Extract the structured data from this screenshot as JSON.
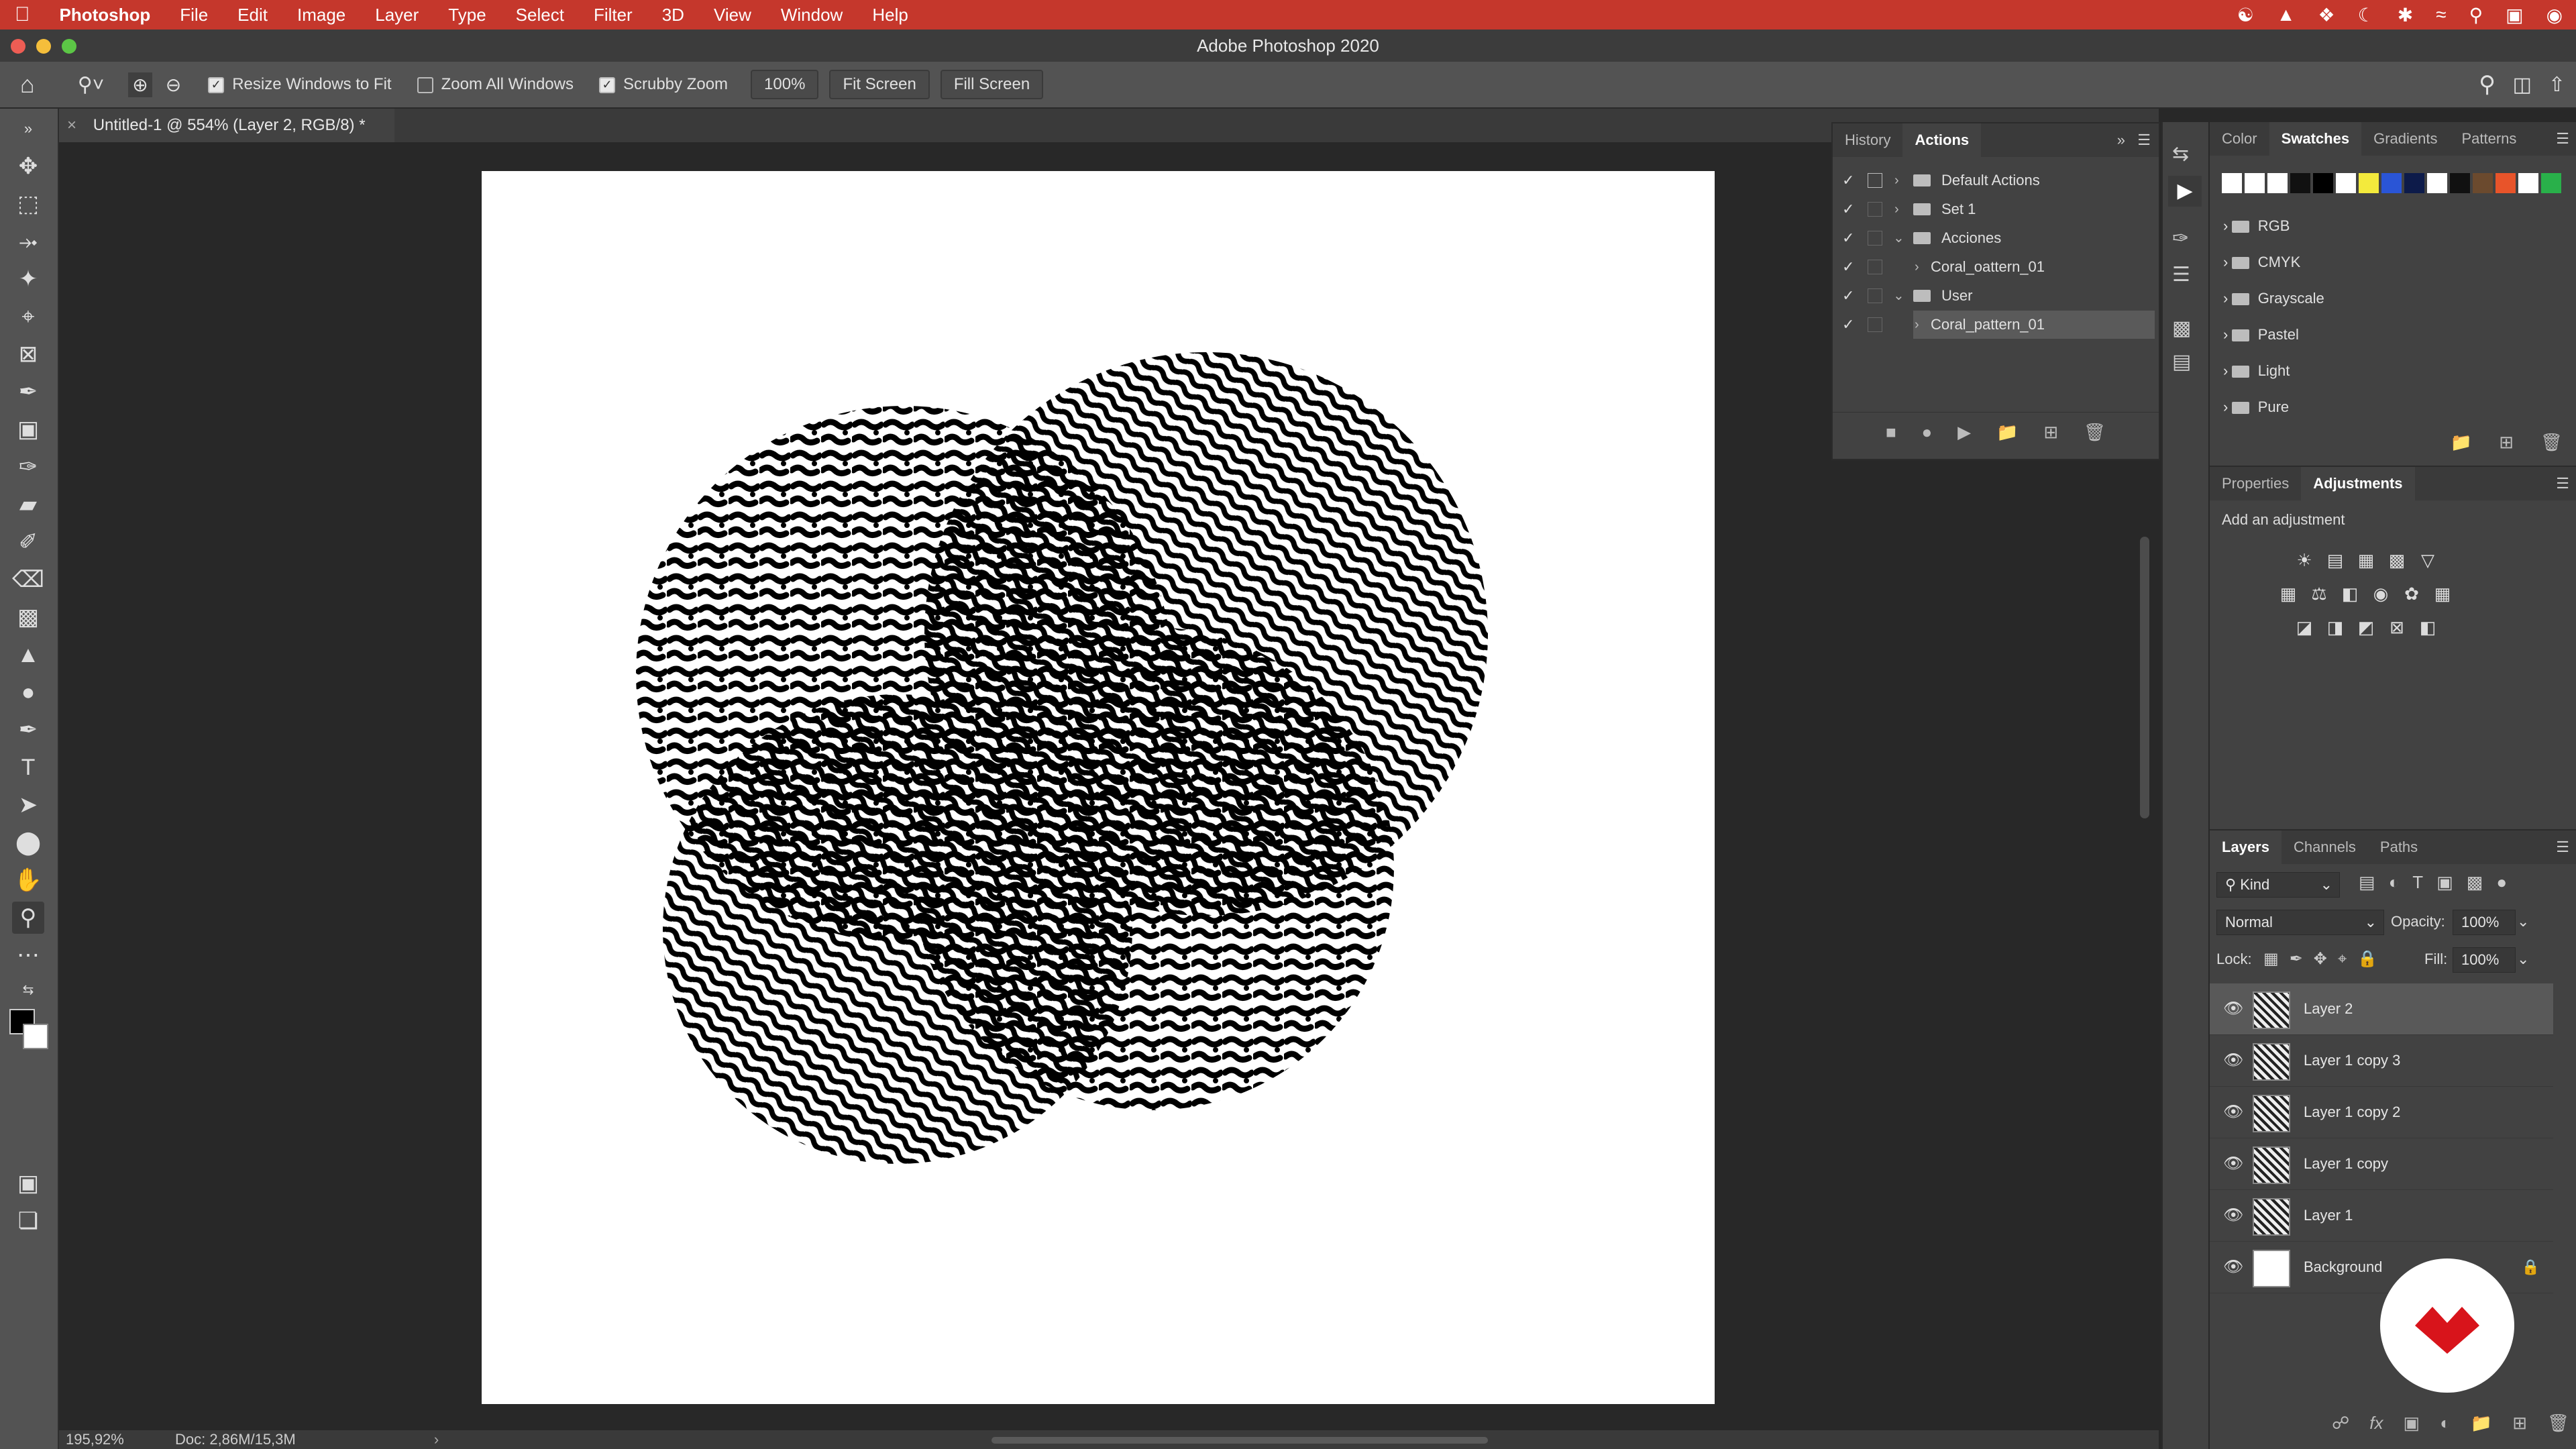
{
  "menubar": {
    "app": "Photoshop",
    "items": [
      "File",
      "Edit",
      "Image",
      "Layer",
      "Type",
      "Select",
      "Filter",
      "3D",
      "View",
      "Window",
      "Help"
    ]
  },
  "window": {
    "title": "Adobe Photoshop 2020"
  },
  "options": {
    "resize_windows": "Resize Windows to Fit",
    "zoom_all": "Zoom All Windows",
    "scrubby": "Scrubby Zoom",
    "zoom_value": "100%",
    "fit_screen": "Fit Screen",
    "fill_screen": "Fill Screen",
    "resize_checked": true,
    "zoom_all_checked": false,
    "scrubby_checked": true
  },
  "document": {
    "tab_title": "Untitled-1 @ 554% (Layer 2, RGB/8) *",
    "zoom": "195,92%",
    "doc_info": "Doc: 2,86M/15,3M"
  },
  "actions_panel": {
    "tabs": [
      "History",
      "Actions"
    ],
    "active_tab": "Actions",
    "rows": [
      "Default Actions",
      "Set 1",
      "Acciones",
      "Coral_oattern_01",
      "User",
      "Coral_pattern_01"
    ]
  },
  "swatches_panel": {
    "tabs": [
      "Color",
      "Swatches",
      "Gradients",
      "Patterns"
    ],
    "active_tab": "Swatches",
    "colors": [
      "#ffffff",
      "#ffffff",
      "#ffffff",
      "#111111",
      "#000000",
      "#ffffff",
      "#f3ea3c",
      "#2a55d6",
      "#0d1b4a",
      "#ffffff",
      "#111111",
      "#6b4a2e",
      "#e8542a",
      "#ffffff",
      "#29b04a"
    ],
    "groups": [
      "RGB",
      "CMYK",
      "Grayscale",
      "Pastel",
      "Light",
      "Pure"
    ]
  },
  "adjustments_panel": {
    "tabs": [
      "Properties",
      "Adjustments"
    ],
    "active_tab": "Adjustments",
    "hint": "Add an adjustment"
  },
  "layers_panel": {
    "tabs": [
      "Layers",
      "Channels",
      "Paths"
    ],
    "active_tab": "Layers",
    "kind": "Kind",
    "blend_mode": "Normal",
    "opacity_label": "Opacity:",
    "opacity": "100%",
    "lock_label": "Lock:",
    "fill_label": "Fill:",
    "fill": "100%",
    "layers": [
      "Layer 2",
      "Layer 1 copy 3",
      "Layer 1 copy 2",
      "Layer 1 copy",
      "Layer 1",
      "Background"
    ],
    "selected": "Layer 2"
  }
}
